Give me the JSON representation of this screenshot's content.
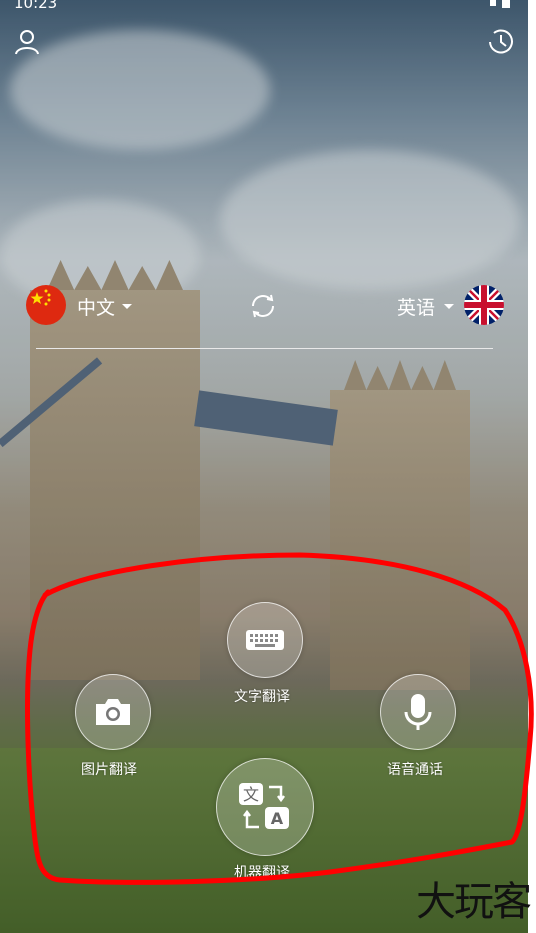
{
  "status": {
    "time": "10:23",
    "icons": [
      "image-icon",
      "wifi-icon",
      "battery-icon"
    ]
  },
  "header": {
    "profile_icon": "user-icon",
    "history_icon": "clock-history-icon"
  },
  "languages": {
    "source": {
      "label": "中文",
      "flag": "china-flag"
    },
    "swap_icon": "swap-icon",
    "target": {
      "label": "英语",
      "flag": "uk-flag"
    }
  },
  "actions": {
    "text_translate": {
      "label": "文字翻译",
      "icon": "keyboard-icon"
    },
    "photo_translate": {
      "label": "图片翻译",
      "icon": "camera-icon"
    },
    "voice_call": {
      "label": "语音通话",
      "icon": "microphone-icon"
    },
    "machine_translate": {
      "label": "机器翻译",
      "icon": "translate-icon"
    }
  },
  "watermark": "大玩客",
  "colors": {
    "annotation": "#ff0000",
    "divider": "#e9e9e9"
  }
}
